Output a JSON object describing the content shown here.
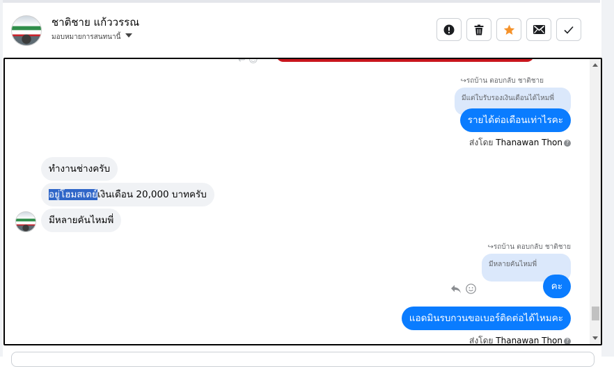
{
  "header": {
    "contact_name": "ชาติชาย แก้ววรรณ",
    "assign_label": "มอบหมายการสนทนานี้",
    "actions": [
      {
        "icon": "alert-icon",
        "color": "#1c1e21"
      },
      {
        "icon": "trash-icon",
        "color": "#1c1e21"
      },
      {
        "icon": "star-icon",
        "color": "#f5922a"
      },
      {
        "icon": "mail-icon",
        "color": "#1c1e21"
      },
      {
        "icon": "check-icon",
        "color": "#1c1e21"
      }
    ]
  },
  "messages": [
    {
      "side": "right",
      "reply_label": "รถบ้าน ตอบกลับ ชาติชาย",
      "quoted": "มีแต่ใบรับรองเงินเดือนได้ไหมพี่",
      "text": "รายได้ต่อเดือนเท่าไรคะ",
      "sent_by_prefix": "ส่งโดย",
      "sent_by_name": "Thanawan Thon"
    },
    {
      "side": "left",
      "text": "ทำงานช่างครับ"
    },
    {
      "side": "left",
      "selected_text": "อยู่โฮมสเตย์",
      "text_rest": "เงินเดือน 20,000 บาทครับ"
    },
    {
      "side": "left",
      "text": "มีหลายคันไหมพี่"
    },
    {
      "side": "right",
      "reply_label": "รถบ้าน ตอบกลับ ชาติชาย",
      "quoted": "มีหลายคันไหมพี่",
      "text": "คะ"
    },
    {
      "side": "right",
      "text": "แอดมินรบกวนขอเบอร์ติดต่อได้ไหมคะ",
      "sent_by_prefix": "ส่งโดย",
      "sent_by_name": "Thanawan Thon"
    }
  ],
  "colors": {
    "accent_blue": "#0a7cff",
    "quote_bg": "#dbe8fb",
    "incoming_bg": "#f0f2f5",
    "selection": "#2f66c8",
    "star": "#f5922a"
  }
}
